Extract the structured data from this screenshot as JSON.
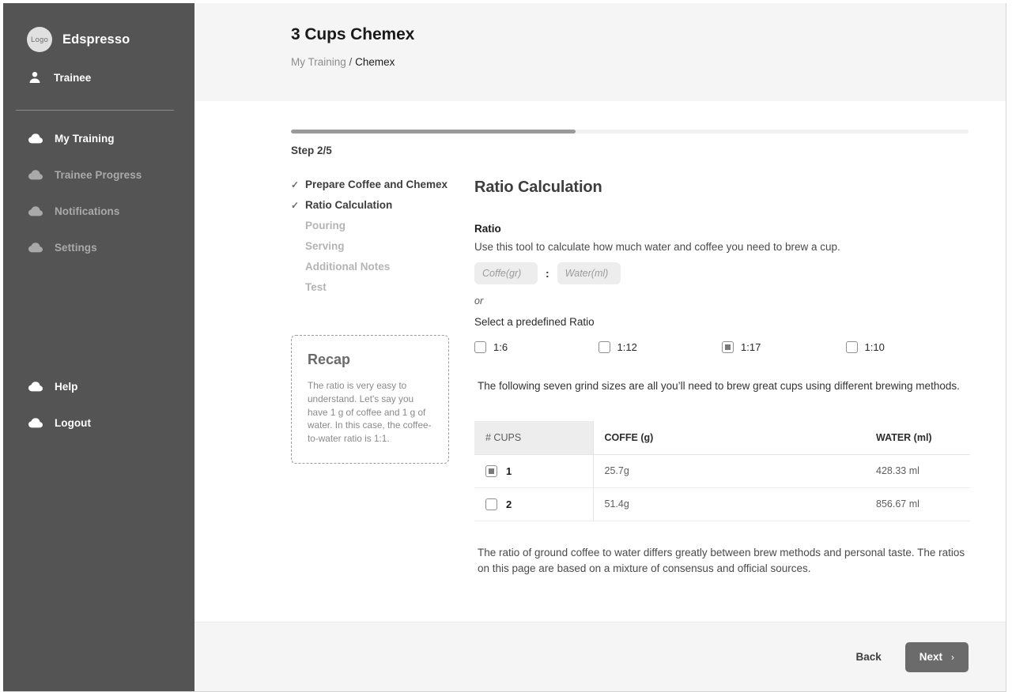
{
  "sidebar": {
    "brand": {
      "logo_text": "Logo",
      "name": "Edspresso"
    },
    "user": {
      "label": "Trainee",
      "icon": "person-icon"
    },
    "items": [
      {
        "label": "My Training",
        "icon": "cloud-icon",
        "active": true
      },
      {
        "label": "Trainee Progress",
        "icon": "cloud-icon",
        "active": false
      },
      {
        "label": "Notifications",
        "icon": "cloud-icon",
        "active": false
      },
      {
        "label": "Settings",
        "icon": "cloud-icon",
        "active": false
      }
    ],
    "bottom_items": [
      {
        "label": "Help",
        "icon": "cloud-icon"
      },
      {
        "label": "Logout",
        "icon": "cloud-icon"
      }
    ]
  },
  "header": {
    "title": "3 Cups Chemex",
    "breadcrumb": {
      "parent": "My Training",
      "separator": "/",
      "current": "Chemex"
    }
  },
  "progress": {
    "step_label": "Step 2/5",
    "percent": 42,
    "fill_color": "#9a9a9a",
    "track_color": "#f1f1f1"
  },
  "steps": [
    {
      "label": "Prepare Coffee and Chemex",
      "state": "done",
      "check": "✓"
    },
    {
      "label": "Ratio Calculation",
      "state": "done",
      "check": "✓"
    },
    {
      "label": "Pouring",
      "state": "todo",
      "check": "✓"
    },
    {
      "label": "Serving",
      "state": "todo",
      "check": "✓"
    },
    {
      "label": "Additional Notes",
      "state": "todo",
      "check": "✓"
    },
    {
      "label": "Test",
      "state": "todo",
      "check": "✓"
    }
  ],
  "recap": {
    "title": "Recap",
    "body": "The ratio is very easy to understand. Let's say you have 1 g of coffee and 1 g of water. In this case, the coffee-to-water ratio is 1:1."
  },
  "main": {
    "section_title": "Ratio Calculation",
    "ratio_label": "Ratio",
    "ratio_description": "Use this tool to calculate how much water and coffee you need to brew a cup.",
    "coffee_input": {
      "value": "",
      "placeholder": "Coffe(gr)"
    },
    "water_input": {
      "value": "",
      "placeholder": "Water(ml)"
    },
    "colon": ":",
    "or_text": "or",
    "predefined_label": "Select a predefined Ratio",
    "ratio_options": [
      {
        "label": "1:6",
        "checked": false
      },
      {
        "label": "1:12",
        "checked": false
      },
      {
        "label": "1:17",
        "checked": true
      },
      {
        "label": "1:10",
        "checked": false
      }
    ],
    "grind_note": "The following seven grind sizes are all you’ll need to brew great cups using different brewing methods.",
    "footnote": "The ratio of ground coffee to water differs greatly between brew methods and personal taste. The ratios on this page are based on a mixture of consensus and official sources."
  },
  "table": {
    "columns": [
      "# CUPS",
      "COFFE (g)",
      "WATER (ml)"
    ],
    "rows": [
      {
        "cups": "1",
        "checked": true,
        "coffee": "25.7g",
        "water": "428.33 ml"
      },
      {
        "cups": "2",
        "checked": false,
        "coffee": "51.4g",
        "water": "856.67 ml"
      }
    ]
  },
  "footer": {
    "back_label": "Back",
    "next_label": "Next",
    "next_arrow": "›"
  },
  "colors": {
    "sidebar_bg": "#545454",
    "panel_bg": "#f5f5f5",
    "accent": "#6b6b6b",
    "muted_text": "#a9a9a9"
  }
}
